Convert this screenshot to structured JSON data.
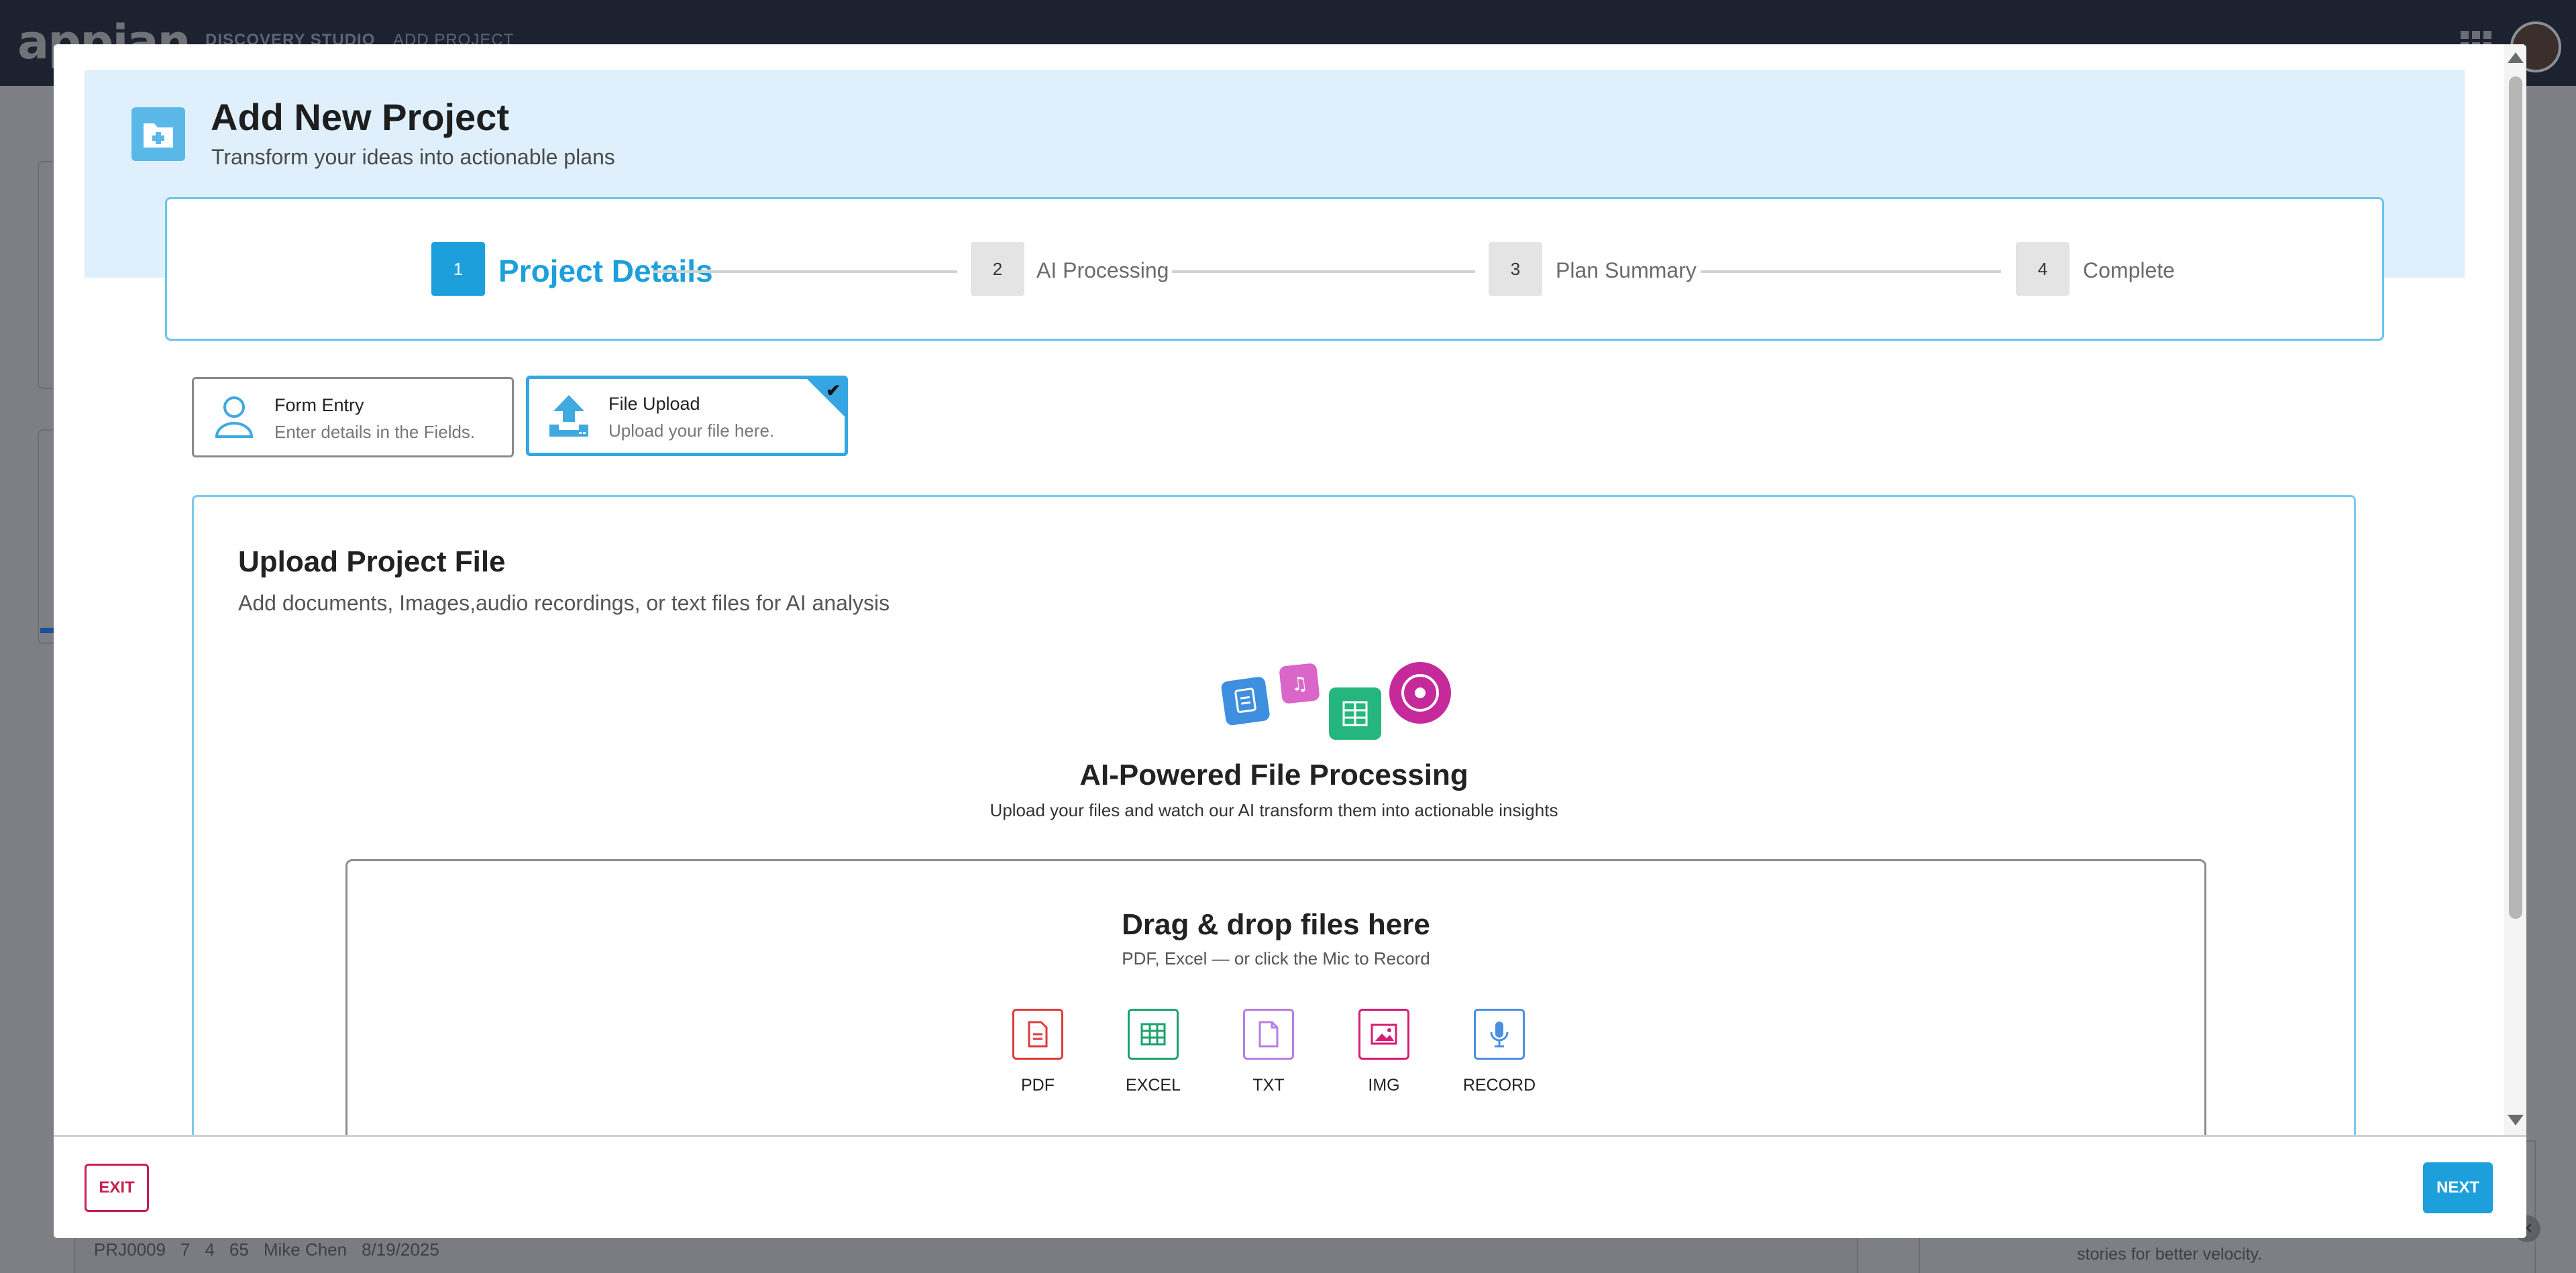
{
  "app": {
    "logo": "appian",
    "nav": [
      "DISCOVERY STUDIO",
      "ADD PROJECT"
    ]
  },
  "background": {
    "project_id": "PRJ0009",
    "folders": "7",
    "actions": "4",
    "time": "65",
    "owner": "Mike Chen",
    "date": "8/19/2025",
    "side_text": "stories for better velocity."
  },
  "header": {
    "title": "Add New Project",
    "subtitle": "Transform your ideas into actionable plans"
  },
  "steps": [
    {
      "num": "1",
      "label": "Project Details",
      "active": true
    },
    {
      "num": "2",
      "label": "AI Processing",
      "active": false
    },
    {
      "num": "3",
      "label": "Plan Summary",
      "active": false
    },
    {
      "num": "4",
      "label": "Complete",
      "active": false
    }
  ],
  "modes": [
    {
      "title": "Form Entry",
      "desc": "Enter details in the Fields.",
      "icon": "user-icon",
      "selected": false
    },
    {
      "title": "File Upload",
      "desc": "Upload your file here.",
      "icon": "upload-icon",
      "selected": true
    }
  ],
  "upload": {
    "title": "Upload Project File",
    "desc": "Add documents, Images,audio recordings, or text files for AI analysis",
    "ai_title": "AI-Powered File Processing",
    "ai_desc": "Upload your files and watch our AI transform them into actionable insights",
    "dropzone_title": "Drag & drop files here",
    "dropzone_desc": "PDF, Excel — or click the Mic to Record",
    "file_types": [
      {
        "label": "PDF",
        "icon": "pdf-icon",
        "color": "#e03a3a"
      },
      {
        "label": "EXCEL",
        "icon": "excel-icon",
        "color": "#1aa36b"
      },
      {
        "label": "TXT",
        "icon": "txt-icon",
        "color": "#b57ee6"
      },
      {
        "label": "IMG",
        "icon": "image-icon",
        "color": "#d81b72"
      },
      {
        "label": "RECORD",
        "icon": "mic-icon",
        "color": "#4a8fe2"
      }
    ]
  },
  "footer": {
    "exit_label": "EXIT",
    "next_label": "NEXT"
  },
  "colors": {
    "accent": "#1d9fdc",
    "exit": "#c7204f",
    "hero_bg": "#dff0fc"
  }
}
